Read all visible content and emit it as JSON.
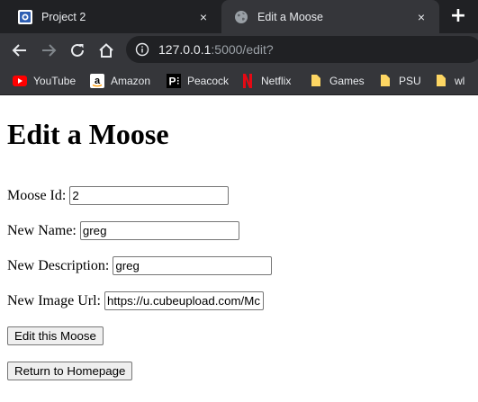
{
  "browser": {
    "tabs": [
      {
        "title": "Project 2",
        "active": false,
        "close_icon": "×"
      },
      {
        "title": "Edit a Moose",
        "active": true,
        "close_icon": "×"
      }
    ],
    "new_tab_icon": "+",
    "address": {
      "host": "127.0.0.1",
      "path": ":5000/edit?"
    },
    "bookmarks": [
      {
        "label": "YouTube",
        "icon": "youtube-icon"
      },
      {
        "label": "Amazon",
        "icon": "amazon-icon"
      },
      {
        "label": "Peacock",
        "icon": "peacock-icon"
      },
      {
        "label": "Netflix",
        "icon": "netflix-icon"
      },
      {
        "label": "Games",
        "icon": "folder-icon"
      },
      {
        "label": "PSU",
        "icon": "folder-icon"
      },
      {
        "label": "wl",
        "icon": "folder-icon"
      }
    ]
  },
  "page": {
    "heading": "Edit a Moose",
    "fields": {
      "moose_id": {
        "label": "Moose Id:",
        "value": "2"
      },
      "new_name": {
        "label": "New Name:",
        "value": "greg"
      },
      "new_description": {
        "label": "New Description:",
        "value": "greg"
      },
      "new_image_url": {
        "label": "New Image Url:",
        "value": "https://u.cubeupload.com/Mc"
      }
    },
    "submit_label": "Edit this Moose",
    "home_label": "Return to Homepage"
  }
}
